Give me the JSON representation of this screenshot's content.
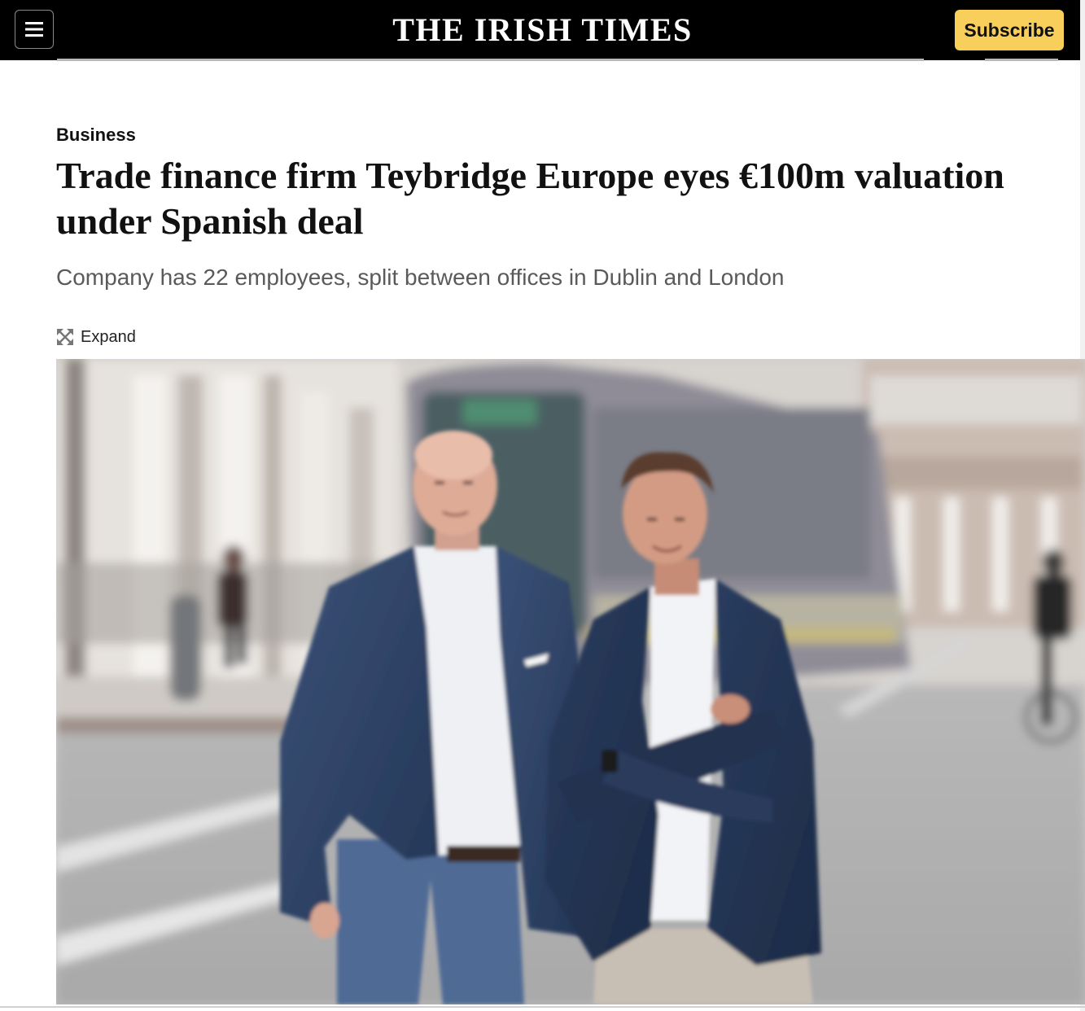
{
  "header": {
    "menu_icon": "hamburger-menu-icon",
    "masthead": "THE IRISH TIMES",
    "subscribe_label": "Subscribe",
    "background_color": "#000000",
    "subscribe_color": "#f8cf5a"
  },
  "article": {
    "section": "Business",
    "headline": "Trade finance firm Teybridge Europe eyes €100m valuation under Spanish deal",
    "standfirst": "Company has 22 employees, split between offices in Dublin and London",
    "expand_label": "Expand",
    "expand_icon": "expand-arrows-icon"
  }
}
